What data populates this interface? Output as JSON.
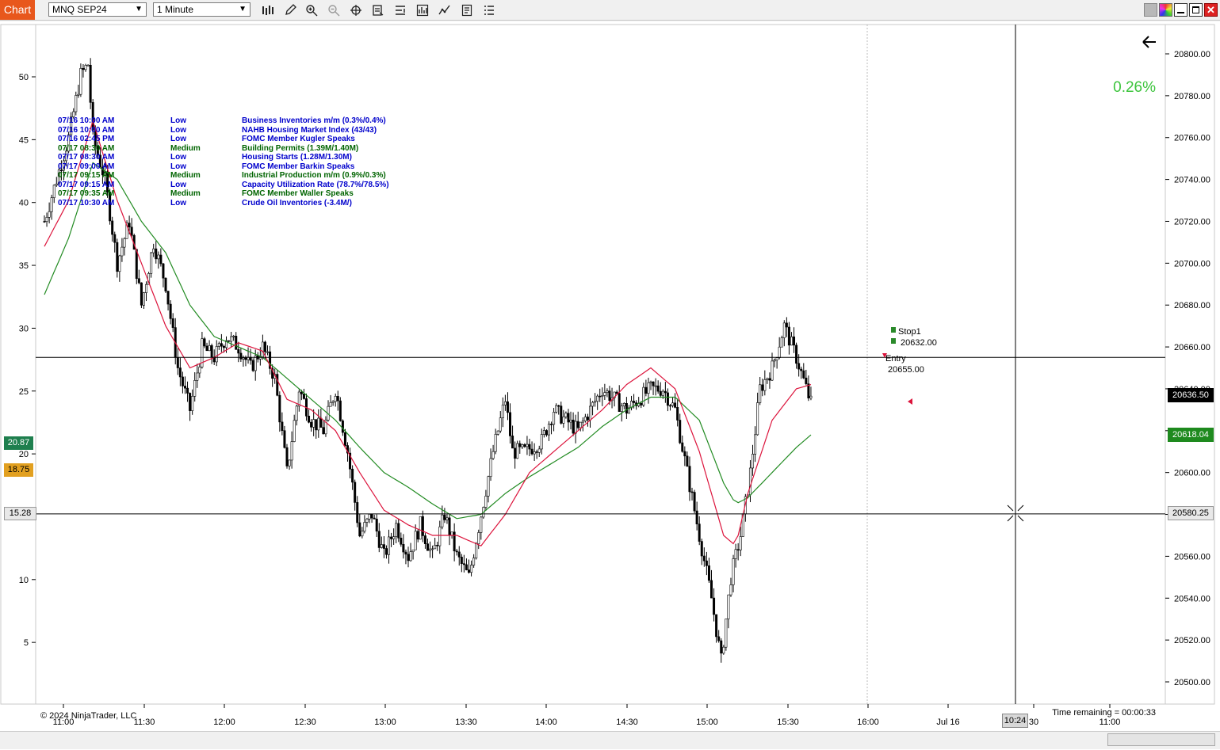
{
  "toolbar": {
    "app_label": "Chart",
    "instrument": "MNQ SEP24",
    "interval": "1 Minute",
    "icons": [
      "bar-type-icon",
      "pencil-icon",
      "zoom-in-icon",
      "zoom-out-icon",
      "crosshair-icon",
      "data-box-icon",
      "properties-icon",
      "strategies-icon",
      "indicators-icon",
      "templates-icon",
      "menu-icon"
    ]
  },
  "window_controls": [
    "workspace-icon",
    "color-icon",
    "minimize-icon",
    "maximize-icon",
    "close-icon"
  ],
  "news": [
    {
      "time": "07/16 10:00 AM",
      "impact": "Low",
      "event": "Business Inventories m/m (0.3%/0.4%)",
      "color": "#0000cc"
    },
    {
      "time": "07/16 10:00 AM",
      "impact": "Low",
      "event": "NAHB Housing Market Index (43/43)",
      "color": "#0000cc"
    },
    {
      "time": "07/16 02:45 PM",
      "impact": "Low",
      "event": "FOMC Member Kugler Speaks",
      "color": "#0000cc"
    },
    {
      "time": "07/17 08:30 AM",
      "impact": "Medium",
      "event": "Building Permits (1.39M/1.40M)",
      "color": "#006400"
    },
    {
      "time": "07/17 08:30 AM",
      "impact": "Low",
      "event": "Housing Starts (1.28M/1.30M)",
      "color": "#0000cc"
    },
    {
      "time": "07/17 09:00 AM",
      "impact": "Low",
      "event": "FOMC Member Barkin Speaks",
      "color": "#0000cc"
    },
    {
      "time": "07/17 09:15 AM",
      "impact": "Medium",
      "event": "Industrial Production m/m (0.9%/0.3%)",
      "color": "#006400"
    },
    {
      "time": "07/17 09:15 AM",
      "impact": "Low",
      "event": "Capacity Utilization Rate (78.7%/78.5%)",
      "color": "#0000cc"
    },
    {
      "time": "07/17 09:35 AM",
      "impact": "Medium",
      "event": "FOMC Member Waller Speaks",
      "color": "#006400"
    },
    {
      "time": "07/17 10:30 AM",
      "impact": "Low",
      "event": "Crude Oil Inventories (-3.4M/)",
      "color": "#0000cc"
    }
  ],
  "percent_change": "0.26%",
  "copyright": "© 2024 NinjaTrader, LLC",
  "time_remaining": "Time remaining = 00:00:33",
  "left_axis": {
    "ticks": [
      "50",
      "45",
      "40",
      "35",
      "30",
      "25",
      "20",
      "15",
      "10",
      "5"
    ],
    "values": [
      50,
      45,
      40,
      35,
      30,
      25,
      20,
      15,
      10,
      5
    ]
  },
  "left_labels": {
    "green": "20.87",
    "orange": "18.75",
    "crosshair": "15.28"
  },
  "right_axis": {
    "ticks": [
      "20800.00",
      "20780.00",
      "20760.00",
      "20740.00",
      "20720.00",
      "20700.00",
      "20680.00",
      "20660.00",
      "20640.00",
      "20620.00",
      "20600.00",
      "20580.00",
      "20560.00",
      "20540.00",
      "20520.00",
      "20500.00"
    ]
  },
  "right_labels": {
    "last_price": "20636.50",
    "ema_value": "20618.04",
    "crosshair_price": "20580.25"
  },
  "time_axis": {
    "ticks": [
      "11:00",
      "11:30",
      "12:00",
      "12:30",
      "13:00",
      "13:30",
      "14:00",
      "14:30",
      "15:00",
      "15:30",
      "16:00",
      "Jul 16",
      "30",
      "11:00"
    ],
    "crosshair_time": "10:24"
  },
  "order_labels": {
    "stop_name": "Stop1",
    "stop_price": "20632.00",
    "entry_name": "Entry",
    "entry_price": "20655.00"
  },
  "colors": {
    "fast_ma": "#dc143c",
    "slow_ma": "#228b22",
    "app_orange": "#e8571c",
    "pct_green": "#3cc43c"
  },
  "chart_data": {
    "type": "candlestick",
    "instrument": "MNQ SEP24",
    "interval": "1 Minute",
    "y_range": [
      20495,
      20815
    ],
    "price_path": [
      [
        0,
        20720
      ],
      [
        5,
        20740
      ],
      [
        10,
        20760
      ],
      [
        15,
        20790
      ],
      [
        18,
        20795
      ],
      [
        20,
        20760
      ],
      [
        25,
        20740
      ],
      [
        30,
        20700
      ],
      [
        35,
        20720
      ],
      [
        40,
        20680
      ],
      [
        45,
        20710
      ],
      [
        50,
        20690
      ],
      [
        55,
        20650
      ],
      [
        60,
        20630
      ],
      [
        65,
        20660
      ],
      [
        70,
        20655
      ],
      [
        75,
        20665
      ],
      [
        80,
        20660
      ],
      [
        85,
        20650
      ],
      [
        90,
        20660
      ],
      [
        95,
        20645
      ],
      [
        100,
        20600
      ],
      [
        105,
        20640
      ],
      [
        110,
        20625
      ],
      [
        115,
        20620
      ],
      [
        120,
        20640
      ],
      [
        125,
        20610
      ],
      [
        130,
        20570
      ],
      [
        135,
        20580
      ],
      [
        140,
        20560
      ],
      [
        145,
        20575
      ],
      [
        150,
        20560
      ],
      [
        155,
        20575
      ],
      [
        160,
        20560
      ],
      [
        165,
        20580
      ],
      [
        170,
        20560
      ],
      [
        175,
        20550
      ],
      [
        180,
        20580
      ],
      [
        185,
        20610
      ],
      [
        190,
        20635
      ],
      [
        193,
        20610
      ],
      [
        198,
        20610
      ],
      [
        205,
        20615
      ],
      [
        210,
        20630
      ],
      [
        220,
        20620
      ],
      [
        230,
        20640
      ],
      [
        240,
        20630
      ],
      [
        250,
        20640
      ],
      [
        255,
        20640
      ],
      [
        260,
        20630
      ],
      [
        265,
        20600
      ],
      [
        270,
        20570
      ],
      [
        275,
        20540
      ],
      [
        279,
        20510
      ],
      [
        283,
        20550
      ],
      [
        287,
        20570
      ],
      [
        291,
        20600
      ],
      [
        295,
        20640
      ],
      [
        300,
        20650
      ],
      [
        305,
        20670
      ],
      [
        310,
        20655
      ],
      [
        315,
        20636.5
      ]
    ],
    "fast_ma": [
      [
        0,
        20708
      ],
      [
        10,
        20730
      ],
      [
        20,
        20768
      ],
      [
        30,
        20730
      ],
      [
        40,
        20700
      ],
      [
        50,
        20670
      ],
      [
        60,
        20650
      ],
      [
        70,
        20655
      ],
      [
        80,
        20662
      ],
      [
        90,
        20658
      ],
      [
        100,
        20635
      ],
      [
        110,
        20630
      ],
      [
        120,
        20620
      ],
      [
        130,
        20600
      ],
      [
        140,
        20582
      ],
      [
        150,
        20575
      ],
      [
        160,
        20570
      ],
      [
        170,
        20570
      ],
      [
        180,
        20565
      ],
      [
        190,
        20580
      ],
      [
        200,
        20600
      ],
      [
        210,
        20610
      ],
      [
        220,
        20620
      ],
      [
        230,
        20630
      ],
      [
        240,
        20642
      ],
      [
        250,
        20650
      ],
      [
        260,
        20640
      ],
      [
        270,
        20610
      ],
      [
        280,
        20570
      ],
      [
        285,
        20565
      ],
      [
        290,
        20590
      ],
      [
        300,
        20625
      ],
      [
        310,
        20640
      ],
      [
        316,
        20642
      ]
    ],
    "slow_ma": [
      [
        0,
        20685
      ],
      [
        10,
        20712
      ],
      [
        20,
        20748
      ],
      [
        30,
        20740
      ],
      [
        40,
        20720
      ],
      [
        50,
        20705
      ],
      [
        60,
        20680
      ],
      [
        70,
        20665
      ],
      [
        80,
        20660
      ],
      [
        90,
        20655
      ],
      [
        100,
        20645
      ],
      [
        110,
        20635
      ],
      [
        120,
        20625
      ],
      [
        130,
        20612
      ],
      [
        140,
        20600
      ],
      [
        150,
        20593
      ],
      [
        160,
        20585
      ],
      [
        170,
        20578
      ],
      [
        180,
        20580
      ],
      [
        190,
        20590
      ],
      [
        200,
        20598
      ],
      [
        210,
        20605
      ],
      [
        220,
        20612
      ],
      [
        230,
        20622
      ],
      [
        240,
        20630
      ],
      [
        250,
        20636
      ],
      [
        260,
        20636
      ],
      [
        270,
        20625
      ],
      [
        280,
        20595
      ],
      [
        285,
        20585
      ],
      [
        290,
        20588
      ],
      [
        300,
        20600
      ],
      [
        310,
        20612
      ],
      [
        316,
        20618
      ]
    ],
    "horizontal_lines": [
      20655,
      20580.25
    ],
    "stop_price": 20632.0,
    "entry_price": 20655.0,
    "last_price": 20636.5
  }
}
